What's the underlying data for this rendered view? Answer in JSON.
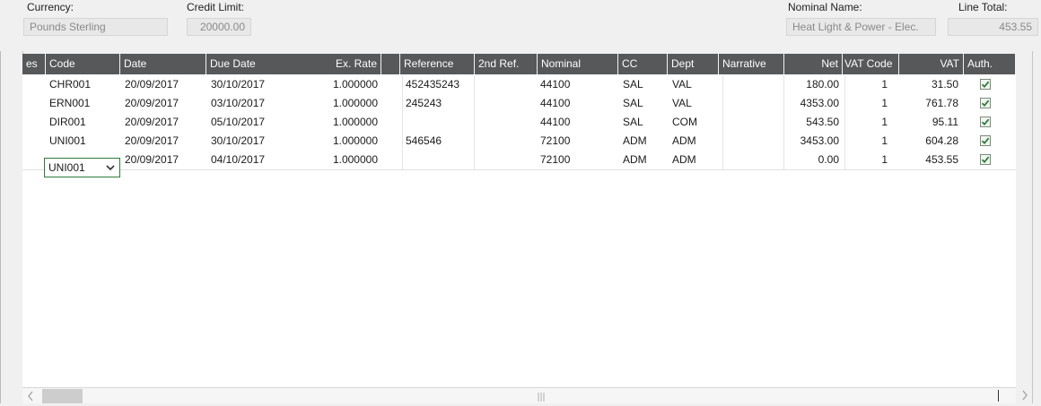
{
  "header": {
    "currency_label": "Currency:",
    "currency_value": "Pounds Sterling",
    "credit_limit_label": "Credit Limit:",
    "credit_limit_value": "20000.00",
    "nominal_name_label": "Nominal Name:",
    "nominal_name_value": "Heat Light & Power - Elec.",
    "line_total_label": "Line Total:",
    "line_total_value": "453.55"
  },
  "grid": {
    "columns": {
      "partial": "es",
      "code": "Code",
      "date": "Date",
      "due_date": "Due Date",
      "ex_rate": "Ex. Rate",
      "reference": "Reference",
      "second_ref": "2nd Ref.",
      "nominal": "Nominal",
      "cc": "CC",
      "dept": "Dept",
      "narrative": "Narrative",
      "net": "Net",
      "vat_code": "VAT Code",
      "vat": "VAT",
      "auth": "Auth."
    },
    "rows": [
      {
        "code": "CHR001",
        "date": "20/09/2017",
        "due_date": "30/10/2017",
        "ex_rate": "1.000000",
        "reference": "452435243",
        "second_ref": "",
        "nominal": "44100",
        "cc": "SAL",
        "dept": "VAL",
        "narrative": "",
        "net": "180.00",
        "vat_code": "1",
        "vat": "31.50",
        "auth": true
      },
      {
        "code": "ERN001",
        "date": "20/09/2017",
        "due_date": "03/10/2017",
        "ex_rate": "1.000000",
        "reference": "245243",
        "second_ref": "",
        "nominal": "44100",
        "cc": "SAL",
        "dept": "VAL",
        "narrative": "",
        "net": "4353.00",
        "vat_code": "1",
        "vat": "761.78",
        "auth": true
      },
      {
        "code": "DIR001",
        "date": "20/09/2017",
        "due_date": "05/10/2017",
        "ex_rate": "1.000000",
        "reference": "",
        "second_ref": "",
        "nominal": "44100",
        "cc": "SAL",
        "dept": "COM",
        "narrative": "",
        "net": "543.50",
        "vat_code": "1",
        "vat": "95.11",
        "auth": true
      },
      {
        "code": "UNI001",
        "date": "20/09/2017",
        "due_date": "30/10/2017",
        "ex_rate": "1.000000",
        "reference": "546546",
        "second_ref": "",
        "nominal": "72100",
        "cc": "ADM",
        "dept": "ADM",
        "narrative": "",
        "net": "3453.00",
        "vat_code": "1",
        "vat": "604.28",
        "auth": true
      },
      {
        "code": "UNI001",
        "date": "20/09/2017",
        "due_date": "04/10/2017",
        "ex_rate": "1.000000",
        "reference": "",
        "second_ref": "",
        "nominal": "72100",
        "cc": "ADM",
        "dept": "ADM",
        "narrative": "",
        "net": "0.00",
        "vat_code": "1",
        "vat": "453.55",
        "auth": true
      }
    ]
  },
  "icons": {
    "dropdown": "chevron-down-icon",
    "auth_checkbox": "checkmark-icon",
    "scroll_left": "chevron-left-icon",
    "scroll_right": "chevron-right-icon"
  },
  "colors": {
    "header_bg": "#57585a",
    "check_green": "#2f7a3a",
    "active_border": "#2f7a3a"
  }
}
